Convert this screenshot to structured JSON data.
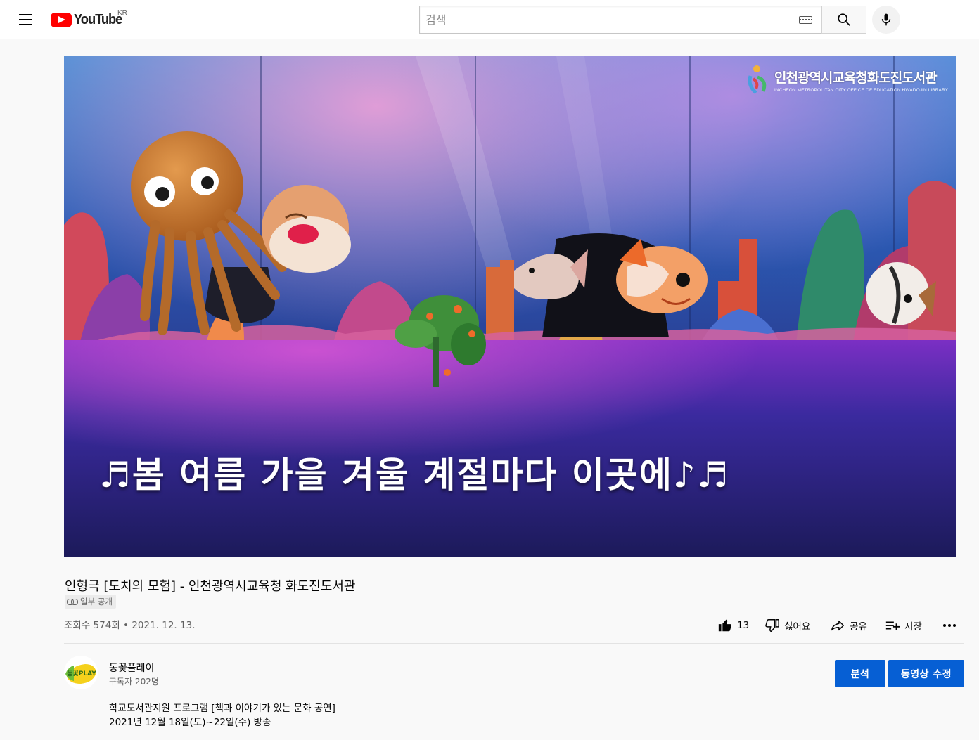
{
  "masthead": {
    "logo_text": "YouTube",
    "country_code": "KR",
    "search_placeholder": "검색",
    "icons": [
      "menu-icon",
      "youtube-logo",
      "keyboard-icon",
      "search-icon",
      "mic-icon"
    ]
  },
  "player": {
    "watermark_ko": "인천광역시교육청화도진도서관",
    "watermark_en": "INCHEON METROPOLITAN CITY OFFICE OF EDUCATION HWADOJIN LIBRARY",
    "subtitle": "♬봄 여름 가을 겨울 계절마다 이곳에♪♬"
  },
  "video": {
    "title": "인형극 [도치의 모험] - 인천광역시교육청 화도진도서관",
    "privacy_label": "일부 공개",
    "views": "조회수 574회",
    "separator": "•",
    "date": "2021. 12. 13."
  },
  "actions": {
    "like_count": "13",
    "dislike_label": "싫어요",
    "share_label": "공유",
    "save_label": "저장"
  },
  "channel": {
    "avatar_text": "동꽃PLAY",
    "name": "동꽃플레이",
    "subscribers": "구독자 202명",
    "analytics_button": "분석",
    "edit_button": "동영상 수정"
  },
  "description": {
    "lines": [
      "학교도서관지원 프로그램 [책과 이야기가 있는 문화 공연]",
      "2021년 12월 18일(토)~22일(수) 방송"
    ]
  },
  "colors": {
    "brand_red": "#ff0000",
    "button_blue": "#065fd4",
    "secondary_text": "#606060"
  }
}
